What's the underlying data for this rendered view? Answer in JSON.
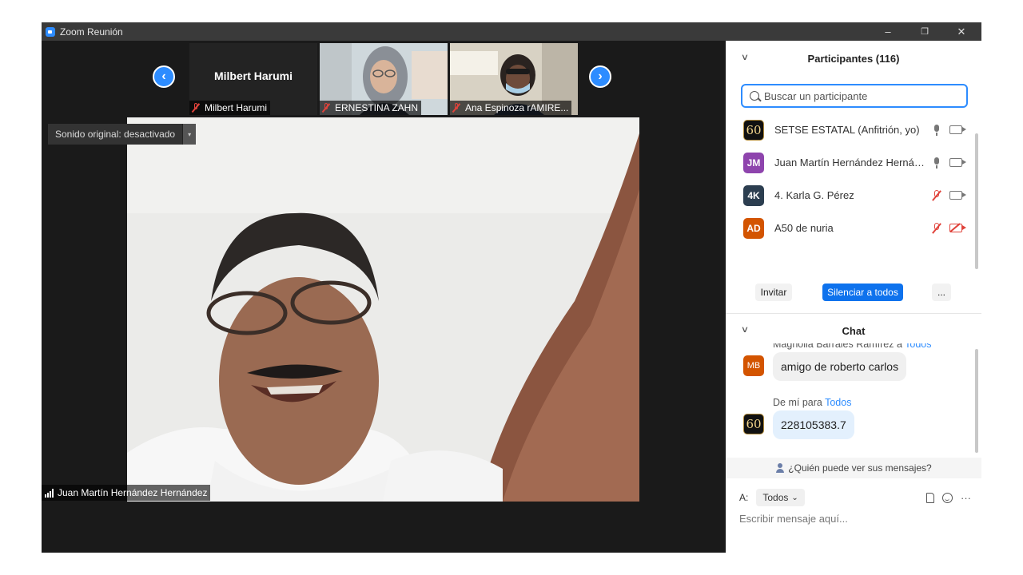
{
  "window": {
    "title": "Zoom Reunión",
    "minimize_glyph": "–",
    "restore_glyph": "❐",
    "close_glyph": "✕"
  },
  "video": {
    "nav_prev_glyph": "‹",
    "nav_next_glyph": "›",
    "thumbnails": [
      {
        "name": "Milbert Harumi",
        "display": "Milbert Harumi",
        "muted": true,
        "video": false
      },
      {
        "name": "ERNESTINA ZAHN",
        "muted": true,
        "video": true
      },
      {
        "name": "Ana Espinoza rAMIRE...",
        "muted": true,
        "video": true
      }
    ],
    "original_sound": {
      "label": "Sonido original: desactivado",
      "dropdown_glyph": "▾"
    },
    "active_speaker": "Juan Martín Hernández Hernández"
  },
  "participants": {
    "title": "Participantes (116)",
    "collapse_glyph": "∨",
    "search_placeholder": "Buscar un participante",
    "list": [
      {
        "initials": "60",
        "name": "SETSE ESTATAL (Anfitrión, yo)",
        "avatar_color": "#111111",
        "mic": "on",
        "cam": "on"
      },
      {
        "initials": "JM",
        "name": "Juan Martín Hernández Hernán...",
        "avatar_color": "#8e44ad",
        "mic": "on",
        "cam": "on"
      },
      {
        "initials": "4K",
        "name": "4. Karla G. Pérez",
        "avatar_color": "#2c3e50",
        "mic": "off",
        "cam": "on"
      },
      {
        "initials": "AD",
        "name": "A50 de nuria",
        "avatar_color": "#d35400",
        "mic": "off",
        "cam": "off"
      }
    ],
    "buttons": {
      "invite": "Invitar",
      "mute_all": "Silenciar a todos",
      "more": "..."
    }
  },
  "chat": {
    "title": "Chat",
    "collapse_glyph": "∨",
    "messages": [
      {
        "sender": "Magnolia Barrales Ramírez",
        "to_word": "a",
        "to": "Todos",
        "avatar": "MB",
        "avatar_color": "#d35400",
        "text": "amigo de roberto carlos",
        "bubble_color": "#f0f0f0"
      },
      {
        "sender": "De mí",
        "to_word": "para",
        "to": "Todos",
        "avatar": "60",
        "avatar_color": "#111111",
        "text": "228105383.7",
        "bubble_color": "#e3f0fd"
      }
    ],
    "who_can_see": "¿Quién puede ver sus mensajes?",
    "to_label": "A:",
    "to_value": "Todos",
    "to_chevron": "⌄",
    "more_glyph": "···",
    "input_placeholder": "Escribir mensaje aquí..."
  }
}
